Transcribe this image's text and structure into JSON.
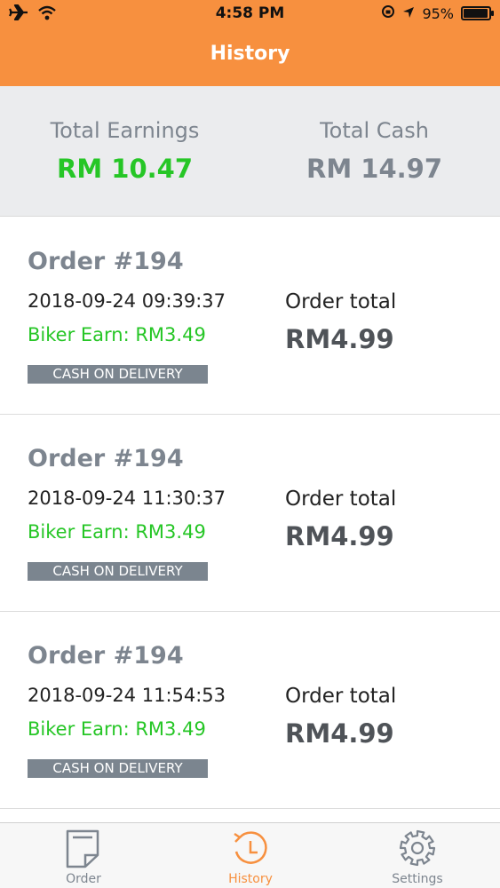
{
  "status_bar": {
    "time": "4:58 PM",
    "battery": "95%",
    "battery_level": 0.95
  },
  "header": {
    "title": "History"
  },
  "summary": {
    "earnings_label": "Total Earnings",
    "earnings_value": "RM 10.47",
    "cash_label": "Total Cash",
    "cash_value": "RM 14.97"
  },
  "orders": [
    {
      "number": "Order #194",
      "datetime": "2018-09-24 09:39:37",
      "earn": "Biker Earn: RM3.49",
      "payment": "CASH ON DELIVERY",
      "total_label": "Order total",
      "total": "RM4.99"
    },
    {
      "number": "Order #194",
      "datetime": "2018-09-24 11:30:37",
      "earn": "Biker Earn: RM3.49",
      "payment": "CASH ON DELIVERY",
      "total_label": "Order total",
      "total": "RM4.99"
    },
    {
      "number": "Order #194",
      "datetime": "2018-09-24 11:54:53",
      "earn": "Biker Earn: RM3.49",
      "payment": "CASH ON DELIVERY",
      "total_label": "Order total",
      "total": "RM4.99"
    }
  ],
  "tabs": [
    {
      "label": "Order",
      "icon": "order-icon"
    },
    {
      "label": "History",
      "icon": "history-icon",
      "active": true
    },
    {
      "label": "Settings",
      "icon": "settings-icon"
    }
  ],
  "colors": {
    "accent": "#f7903f",
    "earn_green": "#26c626",
    "muted_grey": "#7d858f"
  }
}
